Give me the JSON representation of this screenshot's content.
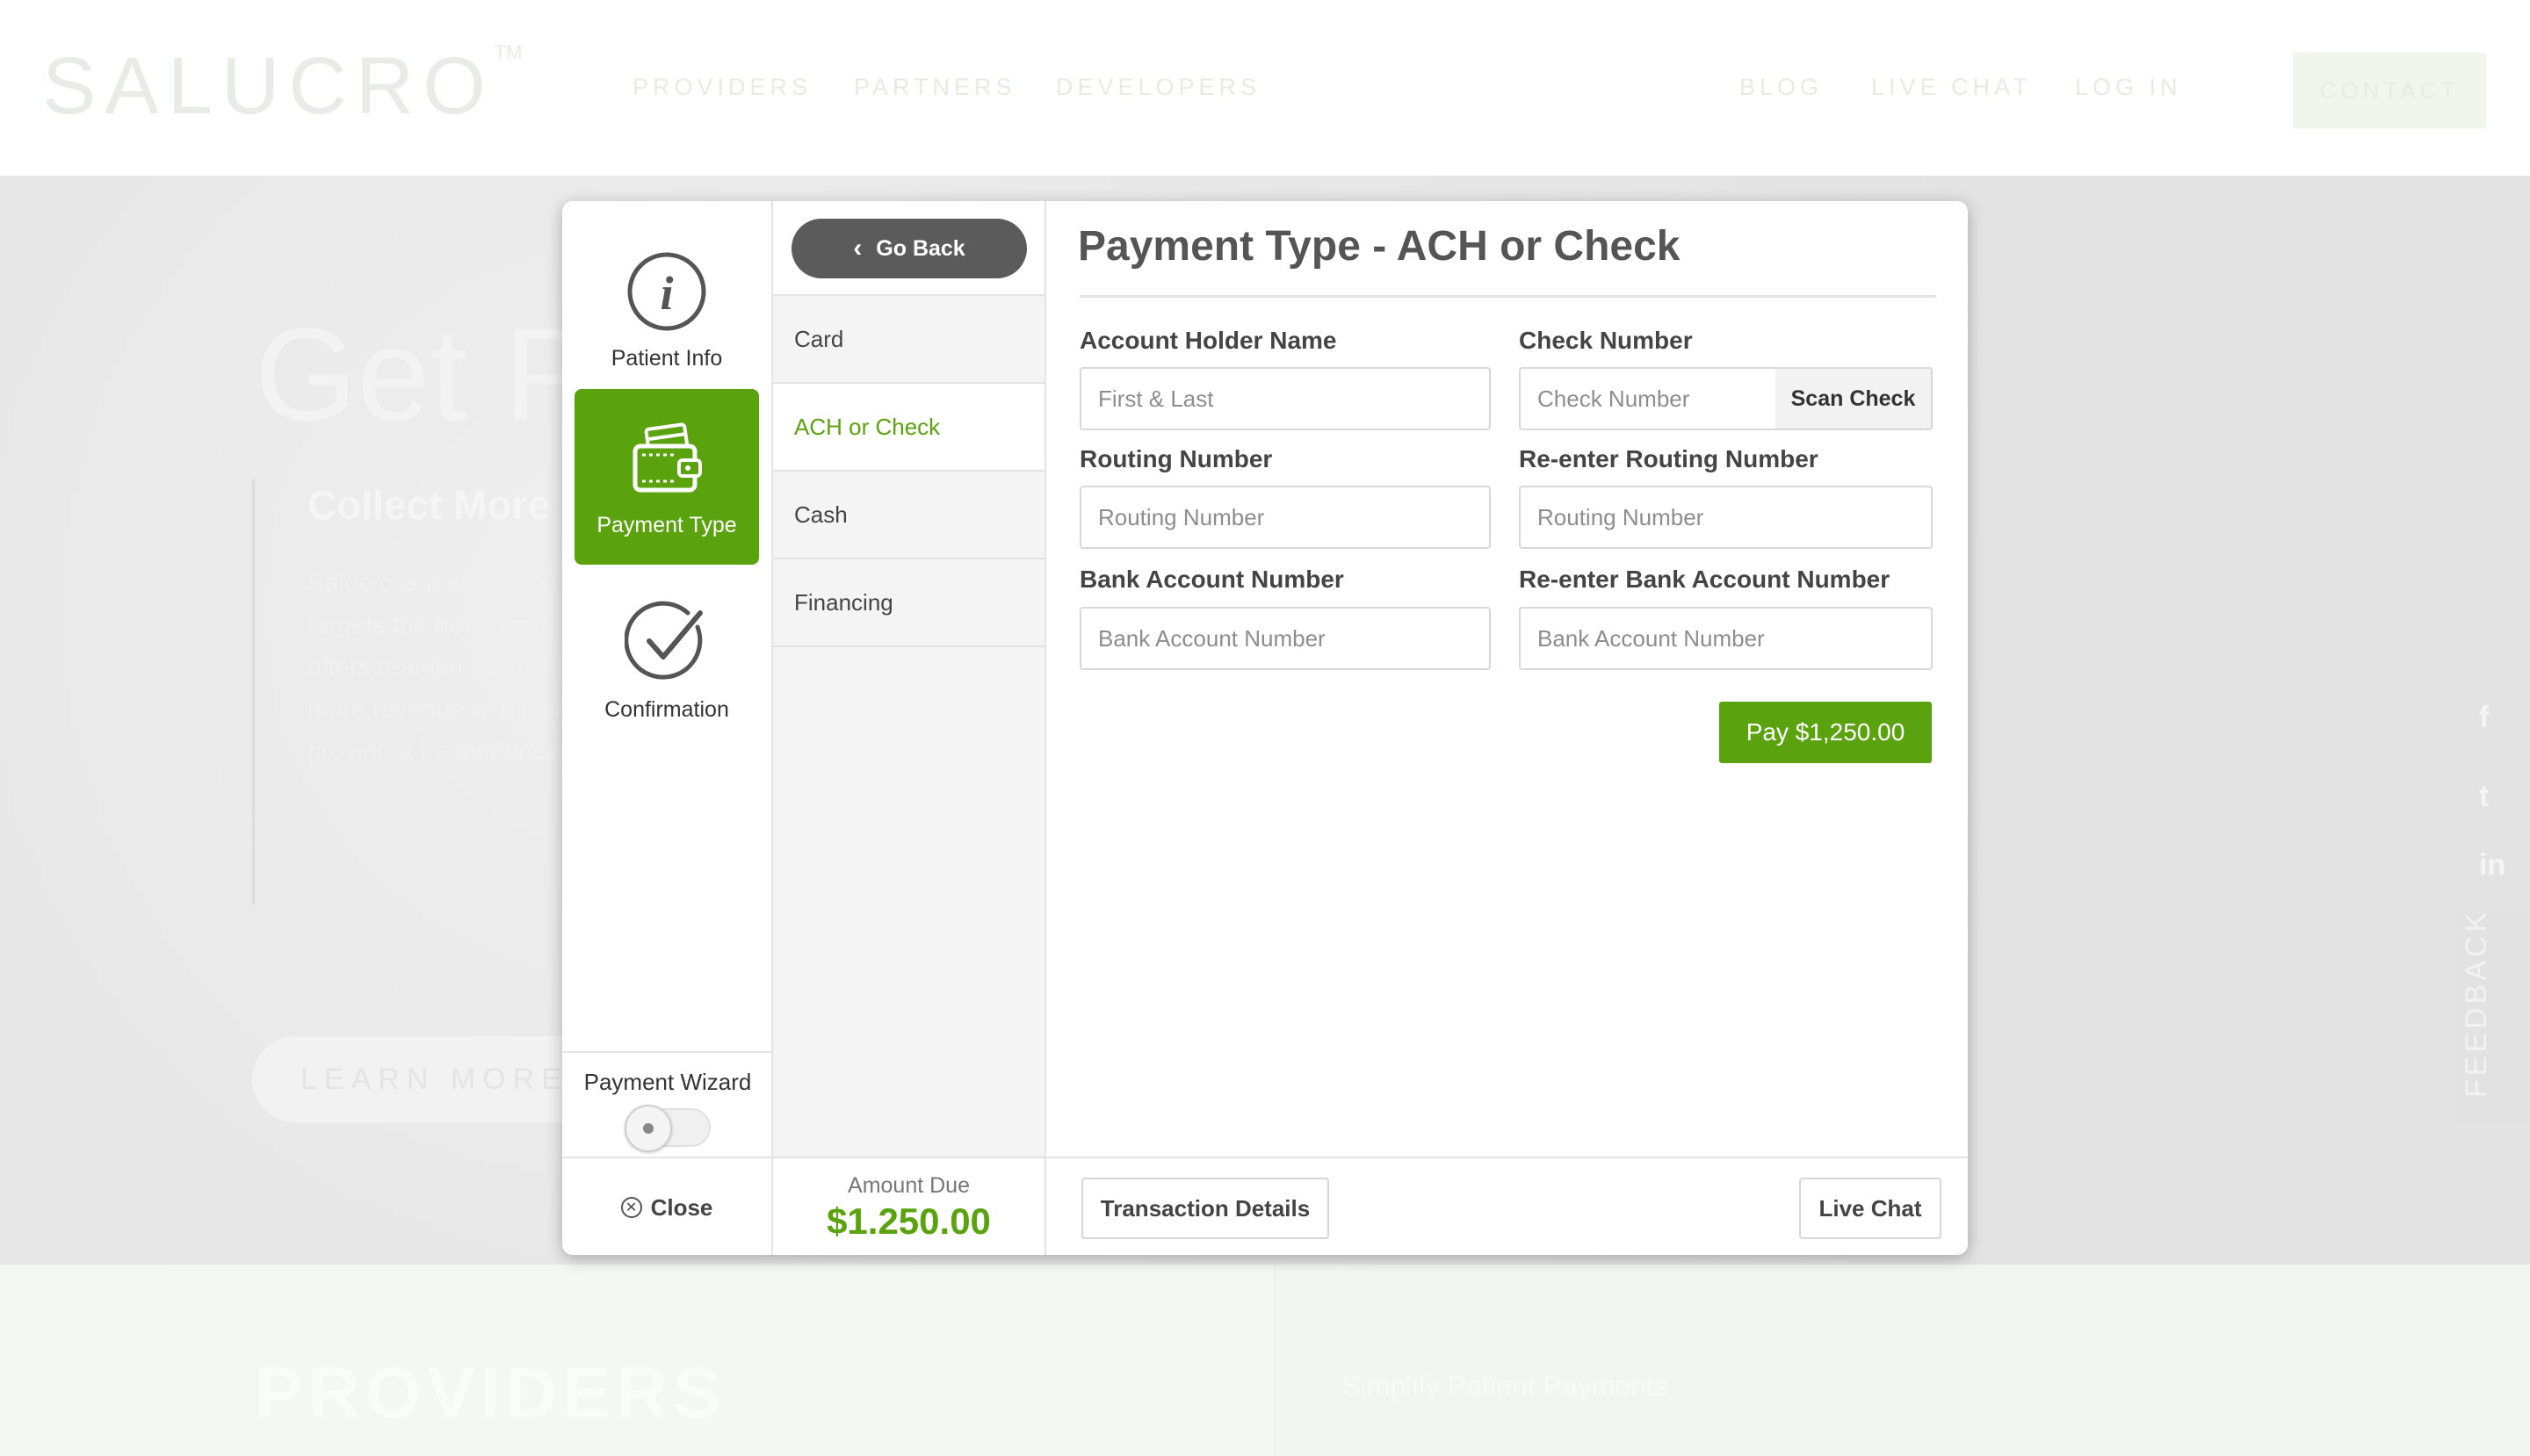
{
  "site": {
    "logo": "SALUCRO",
    "logo_tm": "TM",
    "nav_left": [
      "PROVIDERS",
      "PARTNERS",
      "DEVELOPERS"
    ],
    "nav_right": [
      "BLOG",
      "LIVE CHAT",
      "LOG IN"
    ],
    "contact": "CONTACT",
    "hero_title": "Get Pa",
    "hero_subtitle": "Collect More",
    "hero_paragraph": "Salucro is a cloud-ba solution that targets the healthcare marke Salucro offers real-tim flexible payment optio more revenue at mult cycle and provide a r experience.",
    "learn_more": "LEARN MORE",
    "feedback": "FEEDBACK",
    "providers_title": "PROVIDERS",
    "providers_tagline": "Simplify Patient Payments"
  },
  "modal": {
    "steps": [
      {
        "label": "Patient Info",
        "icon": "info-icon"
      },
      {
        "label": "Payment Type",
        "icon": "wallet-icon"
      },
      {
        "label": "Confirmation",
        "icon": "check-circle-icon"
      }
    ],
    "wizard": {
      "label": "Payment Wizard",
      "enabled": false
    },
    "go_back": "Go Back",
    "payment_types": [
      "Card",
      "ACH or Check",
      "Cash",
      "Financing"
    ],
    "active_type": "ACH or Check",
    "form": {
      "title": "Payment Type - ACH or Check",
      "account_holder": {
        "label": "Account Holder Name",
        "placeholder": "First & Last",
        "value": ""
      },
      "check_number": {
        "label": "Check Number",
        "placeholder": "Check Number",
        "value": ""
      },
      "scan_check": "Scan Check",
      "routing": {
        "label": "Routing Number",
        "placeholder": "Routing Number",
        "value": ""
      },
      "reenter_routing": {
        "label": "Re-enter Routing Number",
        "placeholder": "Routing Number",
        "value": ""
      },
      "bank_account": {
        "label": "Bank Account Number",
        "placeholder": "Bank Account Number",
        "value": ""
      },
      "reenter_bank_account": {
        "label": "Re-enter Bank Account Number",
        "placeholder": "Bank Account Number",
        "value": ""
      },
      "pay_button": "Pay $1,250.00"
    },
    "footer": {
      "close": "Close",
      "amount_label": "Amount Due",
      "amount_value": "$1.250.00",
      "transaction_details": "Transaction Details",
      "live_chat": "Live Chat"
    }
  },
  "colors": {
    "accent_green": "#5aa20e",
    "dark_button": "#5b5b5b"
  }
}
